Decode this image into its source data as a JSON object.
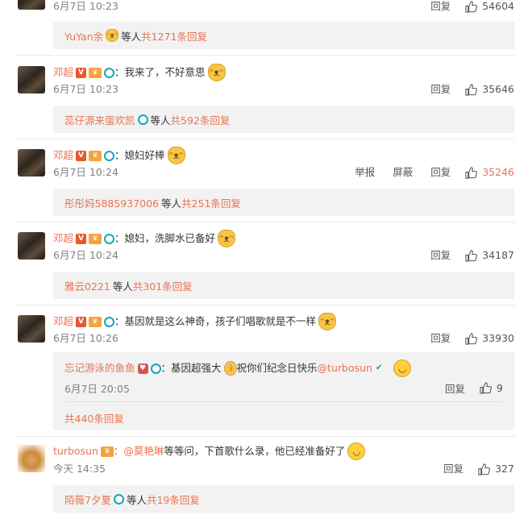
{
  "comments": [
    {
      "date": "6月7日 10:23",
      "reply": "回复",
      "likes": "54604"
    },
    {
      "name": "邓超",
      "text": "：我来了，不好意思",
      "date": "6月7日 10:23",
      "reply": "回复",
      "likes": "35646"
    },
    {
      "name": "邓超",
      "text": "：媳妇好棒",
      "date": "6月7日 10:24",
      "report": "举报",
      "block": "屏蔽",
      "reply": "回复",
      "likes": "35246"
    },
    {
      "name": "邓超",
      "text": "：媳妇，洗脚水已备好",
      "date": "6月7日 10:24",
      "reply": "回复",
      "likes": "34187"
    },
    {
      "name": "邓超",
      "text": "：基因就是这么神奇，孩子们唱歌就是不一样",
      "date": "6月7日 10:26",
      "reply": "回复",
      "likes": "33930"
    },
    {
      "name": "turbosun",
      "mention": "：@莫艳琳",
      "text": " 等等问，下首歌什么录，他已经准备好了",
      "date": "今天 14:35",
      "reply": "回复",
      "likes": "327"
    }
  ],
  "reply_boxes": [
    {
      "user": "YuYan余",
      "mid": " 等人 ",
      "count": "共1271条回复"
    },
    {
      "user": "蕊仔源来蛋欢凯",
      "mid": " 等人 ",
      "count": "共592条回复"
    },
    {
      "user": "彤彤妈5885937006",
      "mid": " 等人 ",
      "count": "共251条回复"
    },
    {
      "user": "雅云0221",
      "mid": " 等人 ",
      "count": "共301条回复"
    },
    {
      "user": "陌薇7夕夏",
      "mid": " 等人 ",
      "count": "共19条回复"
    }
  ],
  "nested_reply": {
    "user": "忘记游泳的鱼鱼",
    "text": "：基因超强大",
    "text2": " 祝你们纪念日快乐",
    "mention": "@turbosun",
    "date": "6月7日 20:05",
    "reply": "回复",
    "likes": "9",
    "total": "共440条回复"
  },
  "colors": {
    "link": "#eb7350",
    "meta": "#808080",
    "box": "#f2f2f2",
    "highlight_like": "#eb7350"
  }
}
